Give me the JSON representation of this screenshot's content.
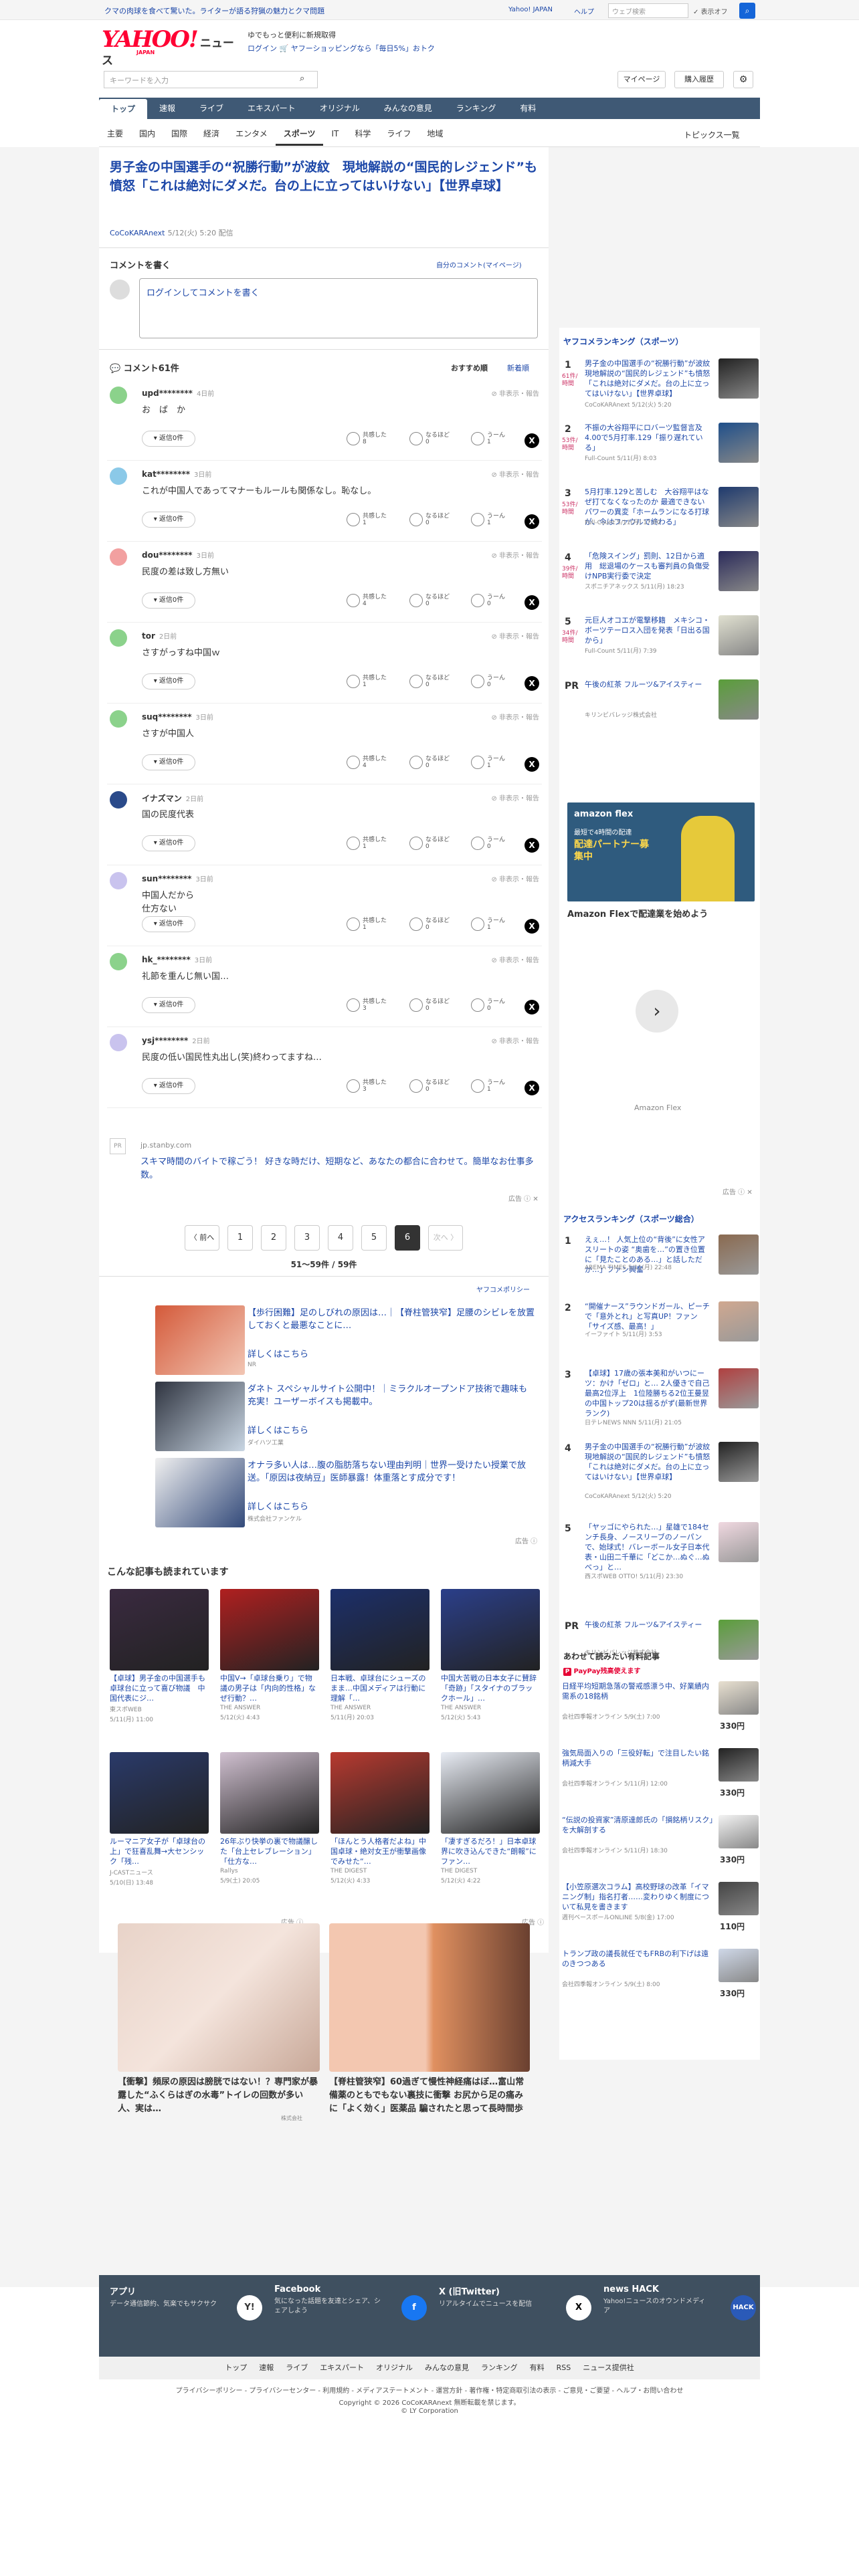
{
  "promo_bar": {
    "text": "クマの肉球を食べて驚いた。ライターが語る狩猟の魅力とクマ問題",
    "yahoo_japan": "Yahoo! JAPAN",
    "help": "ヘルプ",
    "search_placeholder": "ウェブ検索",
    "search_link": "✓ 表示オフ"
  },
  "header": {
    "logo": "YAHOO!",
    "logo_sub": "JAPAN",
    "logo_section": "ニュース",
    "tagline1": "ゆでもっと便利に新規取得",
    "tagline2": "ログイン 🛒 ヤフーショッピングなら「毎日5%」おトク",
    "search_placeholder": "キーワードを入力",
    "mypage": "マイページ",
    "subscribe": "購入履歴"
  },
  "gnav": [
    "トップ",
    "速報",
    "ライブ",
    "エキスパート",
    "オリジナル",
    "みんなの意見",
    "ランキング",
    "有料"
  ],
  "snav": [
    "主要",
    "国内",
    "国際",
    "経済",
    "エンタメ",
    "スポーツ",
    "IT",
    "科学",
    "ライフ",
    "地域"
  ],
  "snav_topics": "トピックス一覧",
  "article": {
    "title": "男子金の中国選手の“祝勝行動”が波紋　現地解説の“国民的レジェンド”も憤怒「これは絶対にダメだ。台の上に立ってはいけない」【世界卓球】",
    "source": "CoCoKARAnext",
    "date": "5/12(火) 5:20 配信"
  },
  "comment_form": {
    "heading": "コメントを書く",
    "my_comments": "自分のコメント(マイページ)",
    "placeholder": "ログインしてコメントを書く"
  },
  "comments_header": {
    "count": "コメント61件",
    "sort_recommended": "おすすめ順",
    "sort_new": "新着順"
  },
  "comments": [
    {
      "user": "upd********",
      "time": "4日前",
      "text": "お　ば　か",
      "agree": "8",
      "naruhodo": "0",
      "un": "1",
      "color": "#8bd28b"
    },
    {
      "user": "kat********",
      "time": "3日前",
      "text": "これが中国人であってマナーもルールも関係なし。恥なし。",
      "agree": "1",
      "naruhodo": "0",
      "un": "1",
      "color": "#8bc9e8"
    },
    {
      "user": "dou********",
      "time": "3日前",
      "text": "民度の差は致し方無い",
      "agree": "4",
      "naruhodo": "0",
      "un": "0",
      "color": "#f2a0a0"
    },
    {
      "user": "tor",
      "time": "2日前",
      "text": "さすがっすね中国ｗ",
      "agree": "1",
      "naruhodo": "0",
      "un": "0",
      "color": "#8bd28b"
    },
    {
      "user": "suq********",
      "time": "3日前",
      "text": "さすが中国人",
      "agree": "4",
      "naruhodo": "0",
      "un": "1",
      "color": "#8bd28b"
    },
    {
      "user": "イナズマン",
      "time": "2日前",
      "text": "国の民度代表",
      "agree": "1",
      "naruhodo": "0",
      "un": "0",
      "color": "#2a4a8a"
    },
    {
      "user": "sun********",
      "time": "3日前",
      "text": "中国人だから\n仕方ない",
      "agree": "1",
      "naruhodo": "0",
      "un": "1",
      "color": "#c9c3ee"
    },
    {
      "user": "hk_********",
      "time": "3日前",
      "text": "礼節を重んじ無い国…",
      "agree": "3",
      "naruhodo": "0",
      "un": "0",
      "color": "#8bd28b"
    },
    {
      "user": "ysj********",
      "time": "2日前",
      "text": "民度の低い国民性丸出し(笑)終わってますね…",
      "agree": "3",
      "naruhodo": "0",
      "un": "1",
      "color": "#c9c3ee"
    }
  ],
  "comment_labels": {
    "reply": "返信0件",
    "agree": "共感した",
    "naruhodo": "なるほど",
    "un": "うーん",
    "report": "非表示・報告"
  },
  "ad_comment": {
    "domain": "jp.stanby.com",
    "text": "スキマ時間のバイトで稼ごう！ 好きな時だけ、短期など、あなたの都合に合わせて。簡単なお仕事多数。",
    "ad": "広告"
  },
  "pager": {
    "prev": "〈 前へ",
    "pages": [
      "1",
      "2",
      "3",
      "4",
      "5",
      "6"
    ],
    "current": "6",
    "next": "次へ 〉",
    "summary": "51〜59件 / 59件"
  },
  "yahoo_policy": "ヤフコメポリシー",
  "ads": [
    {
      "title": "【歩行困難】足のしびれの原因は…｜【脊柱管狭窄】足腰のシビレを放置しておくと最悪なことに…",
      "more": "詳しくはこちら",
      "source": "NR"
    },
    {
      "title": "ダネト スペシャルサイト公開中！｜ミラクルオープンドア技術で趣味も充実！ユーザーボイスも掲載中。",
      "more": "詳しくはこちら",
      "source": "ダイハツ工業"
    },
    {
      "title": "オナラ多い人は…腹の脂肪落ちない理由判明｜世界一受けたい授業で放送。「原因は夜納豆」医師暴露！体重落とす成分です！",
      "more": "詳しくはこちら",
      "source": "株式会社ファンケル"
    }
  ],
  "related_heading": "こんな記事も読まれています",
  "related": [
    {
      "title": "【卓球】男子金の中国選手も卓球台に立って喜び物議　中国代表にジ…",
      "src": "東スポWEB",
      "date": "5/11(月) 11:00"
    },
    {
      "title": "中国V→「卓球台乗り」で物議の男子は「内向的性格」なぜ行動？…",
      "src": "THE ANSWER",
      "date": "5/12(火) 4:43"
    },
    {
      "title": "日本戦、卓球台にシューズのまま…中国メディアは行動に理解「…",
      "src": "THE ANSWER",
      "date": "5/11(月) 20:03"
    },
    {
      "title": "中国大苦戦の日本女子に賛辞「奇跡」「スタイナのブラックホール」…",
      "src": "THE ANSWER",
      "date": "5/12(火) 5:43"
    },
    {
      "title": "ルーマニア女子が「卓球台の上」で狂喜乱舞→大センシック「残…",
      "src": "J-CASTニュース",
      "date": "5/10(日) 13:48"
    },
    {
      "title": "26年ぶり快挙の裏で物議醸した「台上セレブレーション」「仕方な…",
      "src": "Rallys",
      "date": "5/9(土) 20:05"
    },
    {
      "title": "「ほんとう人格者だよね」中国卓球・絶対女王が衝撃画像でみせた“…",
      "src": "THE DIGEST",
      "date": "5/12(火) 4:33"
    },
    {
      "title": "「凄すぎるだろ！」日本卓球界に吹き込んできた“朗報”にファン…",
      "src": "THE DIGEST",
      "date": "5/12(火) 4:22"
    }
  ],
  "big_ads": [
    {
      "title": "【衝撃】頻尿の原因は膀胱ではない！？専門家が暴露した“ふくらはぎの水毒”トイレの回数が多い人、実は…",
      "source": "株式会社"
    },
    {
      "title": "【脊柱管狭窄】60過ぎて慢性神経痛はぼ…富山常備薬のともでもない裏技に衝撃 お尻から足の痛みに「よく効く」医薬品 騙されたと思って長時間歩けない人ためて"
    }
  ],
  "ranking": {
    "heading": "ヤフコメランキング（スポーツ）",
    "items": [
      {
        "num": "1",
        "count": "61件/時間",
        "title": "男子金の中国選手の“祝勝行動”が波紋　現地解説の“国民的レジェンド”も憤怒「これは絶対にダメだ。台の上に立ってはいけない」【世界卓球】",
        "src": "CoCoKARAnext 5/12(火) 5:20"
      },
      {
        "num": "2",
        "count": "53件/時間",
        "title": "不振の大谷翔平にロバーツ監督言及　4.00で5月打率.129「振り遅れている」",
        "src": "Full-Count 5/11(月) 8:03"
      },
      {
        "num": "3",
        "count": "53件/時間",
        "title": "5月打率.129と苦しむ　大谷翔平はなぜ打てなくなったのか 最適できないパワーの異変「ホームランになる打球が、今はファウルで終わる」",
        "src": "Full-Count 5/11(月) 17:00"
      },
      {
        "num": "4",
        "count": "39件/時間",
        "title": "「危険スイング」罰則、12日から適用　総退場のケースも審判員の負傷受けNPB実行委で決定",
        "src": "スポニチアネックス 5/11(月) 18:23"
      },
      {
        "num": "5",
        "count": "34件/時間",
        "title": "元巨人オコエが電撃移籍　メキシコ・ボーツテーロス入団を発表「日出る国から」",
        "src": "Full-Count 5/11(月) 7:39"
      },
      {
        "num": "PR",
        "count": "",
        "title": "午後の紅茶 フルーツ&アイスティー",
        "src": "キリンビバレッジ株式会社"
      }
    ]
  },
  "amazon_ad": {
    "brand": "amazon flex",
    "line1": "最短で4時間の配達",
    "line2": "配達パートナー募集中",
    "caption": "Amazon Flexで配達業を始めよう",
    "brand2": "Amazon Flex",
    "ad": "広告"
  },
  "access_ranking": {
    "heading": "アクセスランキング（スポーツ総合）",
    "items": [
      {
        "num": "1",
        "title": "えぇ…！ 人気上位の“背後”に女性アスリートの姿 “奥歯を…”の置き位置に「見たことのある…」と話しただか…」ファン興奮",
        "src": "ABEMA TIMES 5/11(月) 22:48"
      },
      {
        "num": "2",
        "title": "“開催ナース”ラウンドガール、ピーチで「意外とれ」と写真UP！ファン「サイズ感、最高！」",
        "src": "イーファイト 5/11(月) 3:53"
      },
      {
        "num": "3",
        "title": "【卓球】17歳の張本美和がいつにーツ：かけ「ゼロ」と… 2人優きで自己最高2位浮上　1位陸勝ちる2位王曼昱の中国トップ20は揺るがず(最新世界ランク)",
        "src": "日テレNEWS NNN 5/11(月) 21:05"
      },
      {
        "num": "4",
        "title": "男子金の中国選手の“祝勝行動”が波紋　現地解説の“国民的レジェンド”も憤怒「これは絶対にダメだ。台の上に立ってはいけない」【世界卓球】",
        "src": "CoCoKARAnext 5/12(火) 5:20"
      },
      {
        "num": "5",
        "title": "「ヤッゴにやられた…」星雄で184センチ長身、ノースリーブのノーパンで、始球式！バレーボール女子日本代表・山田二千華に「どこか…ぬぐ…ぬべっ」と…",
        "src": "西スポWEB OTTO! 5/11(月) 23:30"
      },
      {
        "num": "PR",
        "title": "午後の紅茶 フルーツ&アイスティー",
        "src": "キリンビバレッジ株式会社"
      }
    ]
  },
  "paid_news": {
    "heading": "あわせて読みたい有料記事",
    "paypay": "PayPay残高使えます",
    "items": [
      {
        "title": "日経平均短期急落の警戒感漂う中、好業績内需系の18銘柄",
        "src": "会社四季報オンライン 5/9(土) 7:00",
        "price": "330円"
      },
      {
        "title": "強気局面入りの「三役好転」で注目したい銘柄減大手",
        "src": "会社四季報オンライン 5/11(月) 12:00",
        "price": "330円"
      },
      {
        "title": "“伝説の投資家”清原達郎氏の「損銘柄リスク」を大解剖する",
        "src": "会社四季報オンライン 5/11(月) 18:30",
        "price": "330円"
      },
      {
        "title": "【小笠原選次コラム】高校野球の改革「イマニング制」指名打者……変わりゆく制度について私見を書きます",
        "src": "週刊ベースボールONLINE 5/8(金) 17:00",
        "price": "110円"
      },
      {
        "title": "トランプ政の議長就任でもFRBの利下げは遠のきつつある",
        "src": "会社四季報オンライン 5/9(土) 8:00",
        "price": "330円"
      }
    ]
  },
  "footer": {
    "items": [
      {
        "h": "アプリ",
        "d": "データ通信節約、気楽でもサクサク",
        "ic": "Y!"
      },
      {
        "h": "Facebook",
        "d": "気になった話題を友達とシェア、シェアしよう",
        "ic": "f"
      },
      {
        "h": "X (旧Twitter)",
        "d": "リアルタイムでニュースを配信",
        "ic": "X"
      },
      {
        "h": "news HACK",
        "d": "Yahoo!ニュースのオウンドメディア",
        "ic": "HACK"
      }
    ],
    "nav": [
      "トップ",
      "速報",
      "ライブ",
      "エキスパート",
      "オリジナル",
      "みんなの意見",
      "ランキング",
      "有料",
      "RSS",
      "ニュース提供社"
    ],
    "policy": "プライバシーポリシー - プライバシーセンター - 利用規約 - メディアステートメント - 運営方針 - 著作権・特定商取引法の表示 - ご意見・ご要望 - ヘルプ・お問い合わせ",
    "copyright1": "Copyright © 2026 CoCoKARAnext 無断転載を禁じます。",
    "copyright2": "© LY Corporation"
  }
}
